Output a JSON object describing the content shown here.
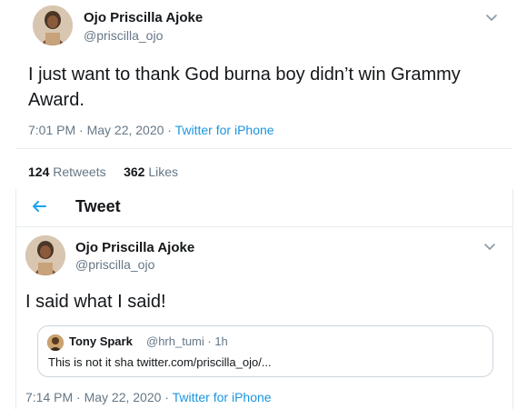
{
  "tweet1": {
    "display_name": "Ojo Priscilla Ajoke",
    "handle": "@priscilla_ojo",
    "text": "I just want to thank God burna boy didn’t win Grammy Award.",
    "time": "7:01 PM · May 22, 2020 · ",
    "source": "Twitter for iPhone",
    "retweets_count": "124",
    "retweets_label": "Retweets",
    "likes_count": "362",
    "likes_label": "Likes"
  },
  "header": {
    "title": "Tweet"
  },
  "tweet2": {
    "display_name": "Ojo Priscilla Ajoke",
    "handle": "@priscilla_ojo",
    "text": "I said what I said!",
    "time": "7:14 PM · May 22, 2020 · ",
    "source": "Twitter for iPhone",
    "quote": {
      "display_name": "Tony Spark",
      "handle_time": "@hrh_tumi · 1h",
      "text": "This is not it sha twitter.com/priscilla_ojo/..."
    }
  },
  "colors": {
    "link": "#1b95e0",
    "muted": "#657786",
    "text": "#14171a",
    "border": "#e6ecf0"
  },
  "icons": [
    "avatar-photo",
    "chevron-down-icon",
    "back-arrow-icon"
  ]
}
